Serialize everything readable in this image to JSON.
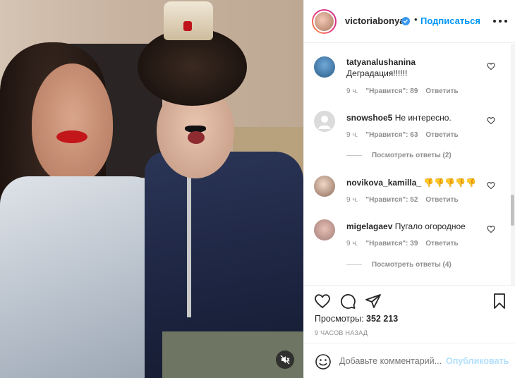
{
  "post": {
    "username": "victoriabonya",
    "follow_label": "Подписаться",
    "dot": "•"
  },
  "comments": [
    {
      "user": "tatyanalushanina",
      "text": "Деградация!!!!!!",
      "time": "9 ч.",
      "likes": "\"Нравится\": 89",
      "reply": "Ответить"
    },
    {
      "user": "snowshoe5",
      "text": "Не интересно.",
      "time": "9 ч.",
      "likes": "\"Нравится\": 63",
      "reply": "Ответить",
      "view_replies": "Посмотреть ответы (2)"
    },
    {
      "user": "novikova_kamilla_",
      "text": "👎👎👎👎👎",
      "time": "9 ч.",
      "likes": "\"Нравится\": 52",
      "reply": "Ответить"
    },
    {
      "user": "migelagaev",
      "text": "Пугало огородное",
      "time": "9 ч.",
      "likes": "\"Нравится\": 39",
      "reply": "Ответить",
      "view_replies": "Посмотреть ответы (4)"
    }
  ],
  "stats": {
    "views_label": "Просмотры:",
    "views_count": "352 213",
    "posted": "9 ЧАСОВ НАЗАД"
  },
  "add_comment": {
    "placeholder": "Добавьте комментарий...",
    "publish_label": "Опубликовать"
  },
  "colors": {
    "accent": "#0095f6",
    "verified": "#3897f0",
    "publish_disabled": "#b2dffc",
    "muted": "#8e8e8e"
  },
  "icons": [
    "mute-icon",
    "verified-icon",
    "more-icon",
    "heart-icon",
    "comment-icon",
    "share-icon",
    "bookmark-icon",
    "emoji-icon"
  ]
}
